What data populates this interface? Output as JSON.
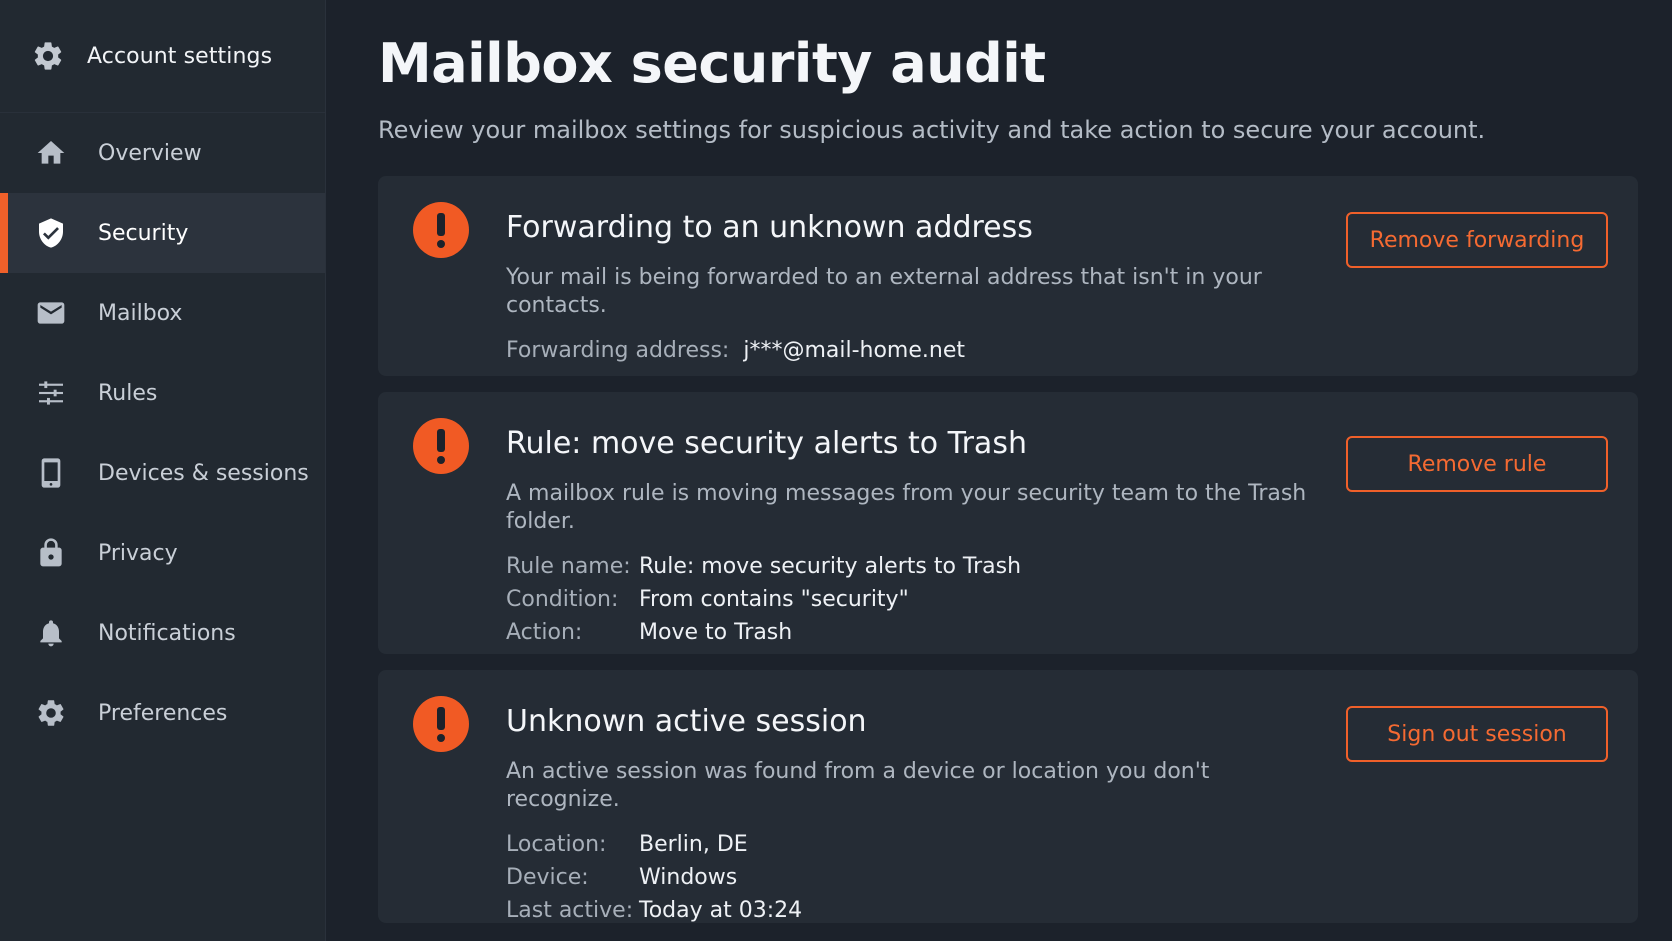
{
  "sidebar": {
    "header": {
      "title": "Account settings",
      "icon": "gear-icon"
    },
    "items": [
      {
        "label": "Overview",
        "icon": "home-icon",
        "active": false
      },
      {
        "label": "Security",
        "icon": "shield-check-icon",
        "active": true
      },
      {
        "label": "Mailbox",
        "icon": "envelope-icon",
        "active": false
      },
      {
        "label": "Rules",
        "icon": "sliders-icon",
        "active": false
      },
      {
        "label": "Devices & sessions",
        "icon": "tablet-icon",
        "active": false
      },
      {
        "label": "Privacy",
        "icon": "lock-icon",
        "active": false
      },
      {
        "label": "Notifications",
        "icon": "bell-icon",
        "active": false
      },
      {
        "label": "Preferences",
        "icon": "gear-icon",
        "active": false
      }
    ]
  },
  "main": {
    "title": "Mailbox security audit",
    "subtitle": "Review your mailbox settings for suspicious activity and take action to secure your account.",
    "cards": [
      {
        "title": "Forwarding to an unknown address",
        "description": "Your mail is being forwarded to an external address that isn't in your contacts.",
        "details": [
          {
            "key": "Forwarding address:",
            "value": "j***@mail-home.net"
          }
        ],
        "action": "Remove forwarding"
      },
      {
        "title": "Rule: move security alerts to Trash",
        "description": "A mailbox rule is moving messages from your security team to the Trash folder.",
        "details": [
          {
            "key": "Rule name:",
            "value": "Rule: move security alerts to Trash"
          },
          {
            "key": "Condition:",
            "value": "From contains \"security\""
          },
          {
            "key": "Action:",
            "value": "Move to Trash"
          }
        ],
        "action": "Remove rule"
      },
      {
        "title": "Unknown active session",
        "description": "An active session was found from a device or location you don't recognize.",
        "details": [
          {
            "key": "Location:",
            "value": "Berlin, DE"
          },
          {
            "key": "Device:",
            "value": "Windows"
          },
          {
            "key": "Last active:",
            "value": "Today at 03:24"
          }
        ],
        "action": "Sign out session"
      }
    ]
  },
  "colors": {
    "accent": "#f0602a",
    "alert": "#f15a24",
    "background": "#1c222b",
    "sidebar": "#222931",
    "card": "#252c35"
  }
}
